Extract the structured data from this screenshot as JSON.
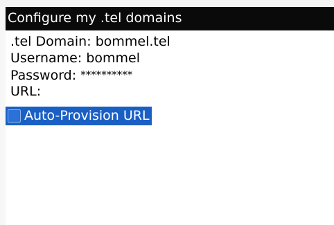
{
  "app": {
    "title": "Configure my .tel domains"
  },
  "form": {
    "domain_label": ".tel Domain:",
    "domain_value": "bommel.tel",
    "username_label": "Username:",
    "username_value": "bommel",
    "password_label": "Password:",
    "password_value": "**********",
    "url_label": "URL:",
    "url_value": "",
    "auto_provision_label": "Auto-Provision URL",
    "auto_provision_checked": false
  },
  "colors": {
    "title_bar": "#0a0a0a",
    "selection": "#1a5fc4",
    "text": "#000000"
  }
}
